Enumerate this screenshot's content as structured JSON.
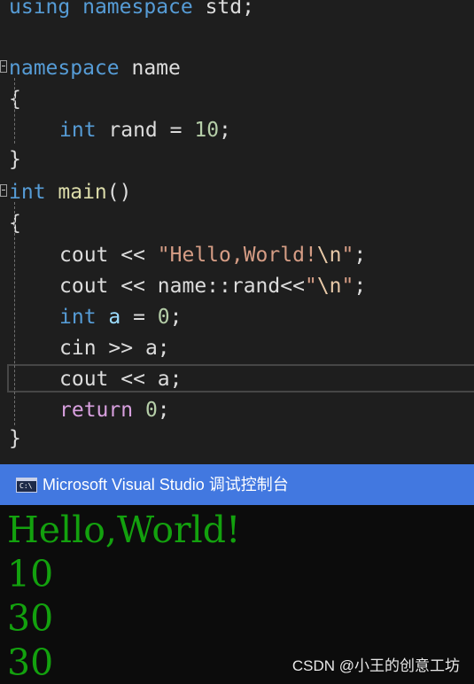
{
  "editor": {
    "lines": {
      "l1": {
        "using": "using",
        "namespace": "namespace",
        "rest": " std;"
      },
      "l2": {
        "namespace": "namespace",
        "name": " name"
      },
      "l3": {
        "brace": "{"
      },
      "l4": {
        "type": "int",
        "name": " rand",
        "eq": " = ",
        "value": "10",
        "end": ";"
      },
      "l5": {
        "brace": "}"
      },
      "l6": {
        "type": "int",
        "name": " main",
        "parens": "()"
      },
      "l7": {
        "brace": "{"
      },
      "l8": {
        "stream": "cout",
        "op": " << ",
        "str": "\"Hello,World!",
        "esc": "\\n",
        "close": "\"",
        "end": ";"
      },
      "l9": {
        "stream": "cout",
        "op": " << ",
        "scoped": "name::rand",
        "op2": "<<",
        "open": "\"",
        "esc": "\\n",
        "close": "\"",
        "end": ";"
      },
      "l10": {
        "type": "int",
        "var": " a",
        "eq": " = ",
        "value": "0",
        "end": ";"
      },
      "l11": {
        "stream": "cin",
        "op": " >> ",
        "var": "a",
        "end": ";"
      },
      "l12": {
        "stream": "cout",
        "op": " << ",
        "var": "a",
        "end": ";"
      },
      "l13": {
        "kw": "return",
        "value": " 0",
        "end": ";"
      },
      "l14": {
        "brace": "}"
      }
    }
  },
  "console": {
    "title": "Microsoft Visual Studio 调试控制台",
    "icon_label": "C:\\",
    "output": [
      "Hello,World!",
      "10",
      "30",
      "30"
    ]
  },
  "watermark": "CSDN @小王的创意工坊",
  "colors": {
    "editor_bg": "#1e1e1e",
    "keyword": "#569cd6",
    "string": "#d69d85",
    "number": "#b5cea8",
    "console_title_bg": "#4278e0",
    "console_bg": "#0c0c0c",
    "console_text": "#13a10e"
  }
}
